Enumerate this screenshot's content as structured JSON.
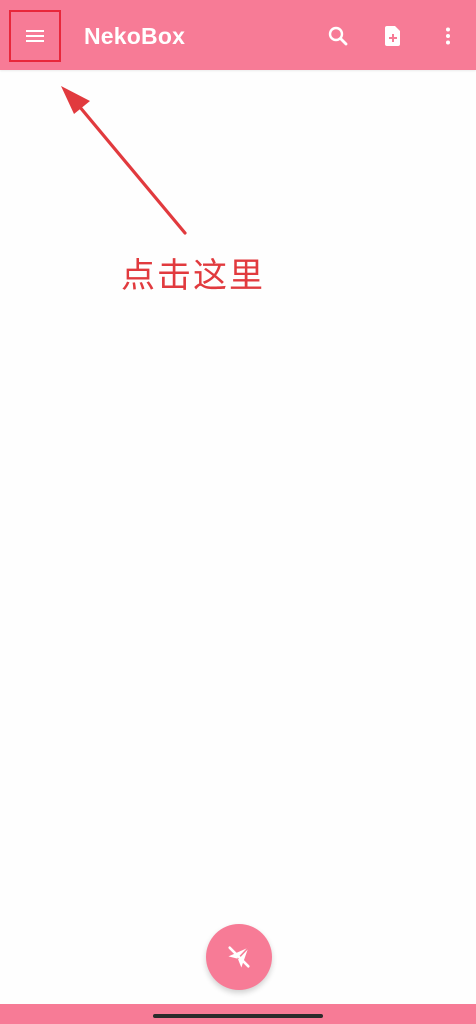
{
  "app_bar": {
    "title": "NekoBox",
    "nav_icon": "menu-icon",
    "actions": [
      {
        "name": "search",
        "icon": "search-icon"
      },
      {
        "name": "new-file",
        "icon": "note-add-icon"
      },
      {
        "name": "more",
        "icon": "more-vert-icon"
      }
    ]
  },
  "annotation": {
    "text": "点击这里",
    "color": "#e13a3e"
  },
  "fab": {
    "icon": "paper-plane-off-icon"
  },
  "colors": {
    "accent": "#f77b96",
    "highlight_box": "#e8273b",
    "background": "#fefefe"
  }
}
